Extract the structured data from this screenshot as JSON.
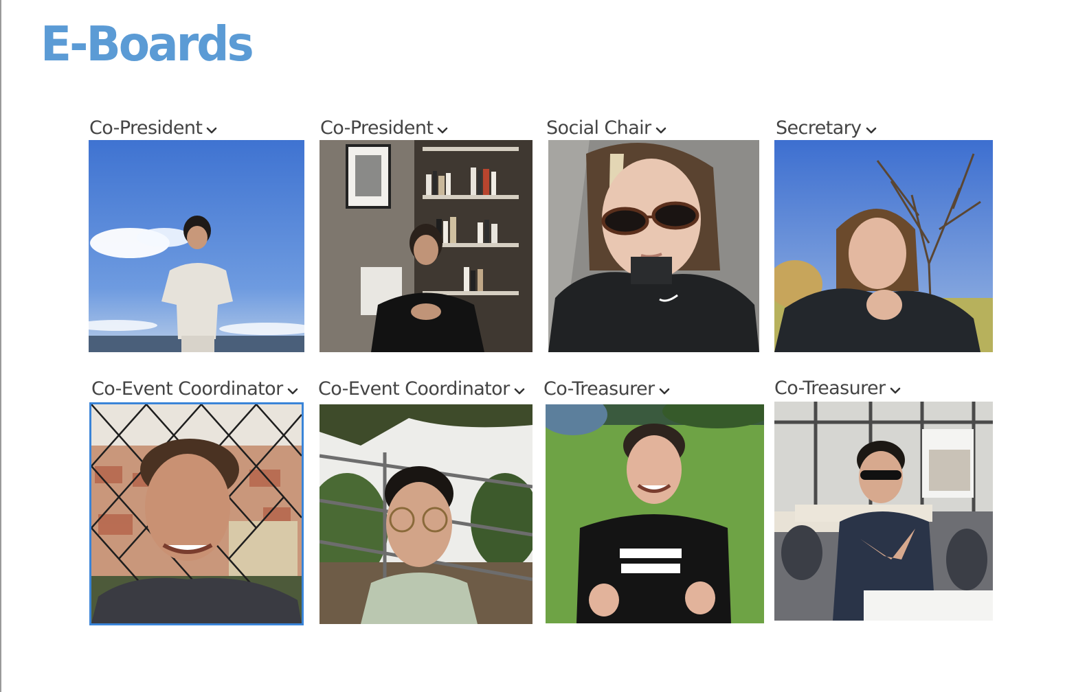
{
  "page": {
    "title": "E-Boards"
  },
  "members": [
    {
      "role": "Co-President",
      "icon": "chevron-down-icon",
      "photo": "sky-portrait"
    },
    {
      "role": "Co-President",
      "icon": "chevron-down-icon",
      "photo": "bookshelf-portrait"
    },
    {
      "role": "Social Chair",
      "icon": "chevron-down-icon",
      "photo": "sunglasses-selfie"
    },
    {
      "role": "Secretary",
      "icon": "chevron-down-icon",
      "photo": "park-portrait"
    },
    {
      "role": "Co-Event Coordinator",
      "icon": "chevron-down-icon",
      "photo": "city-fence-selfie",
      "selected": true
    },
    {
      "role": "Co-Event Coordinator",
      "icon": "chevron-down-icon",
      "photo": "garden-glasses-selfie"
    },
    {
      "role": "Co-Treasurer",
      "icon": "chevron-down-icon",
      "photo": "lawn-thumbs-up"
    },
    {
      "role": "Co-Treasurer",
      "icon": "chevron-down-icon",
      "photo": "cafeteria-portrait"
    }
  ],
  "colors": {
    "title": "#5b9bd5",
    "label": "#444444",
    "selected_border": "#3a84d8"
  }
}
